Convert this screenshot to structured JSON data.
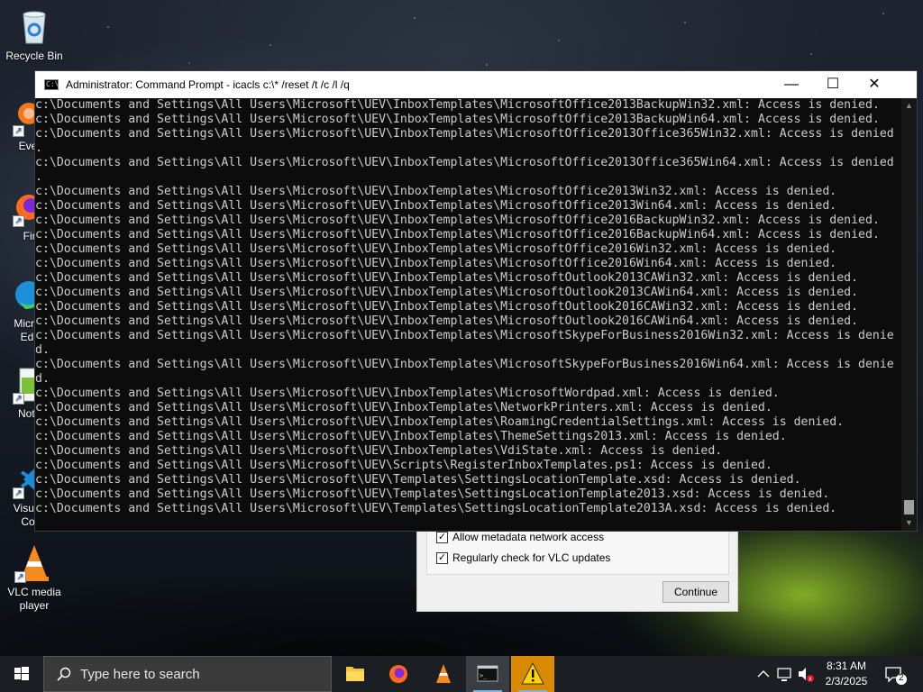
{
  "desktop": {
    "icons": [
      {
        "label": "Recycle Bin",
        "icon": "recycle-bin-icon"
      },
      {
        "label": "Every",
        "icon": "everything-icon"
      },
      {
        "label": "Fire",
        "icon": "firefox-icon"
      },
      {
        "label": "Micro Ed",
        "icon": "edge-icon"
      },
      {
        "label": "Notep",
        "icon": "notepad-icon"
      },
      {
        "label": "Visual Co",
        "icon": "vscode-icon"
      },
      {
        "label": "VLC media player",
        "icon": "vlc-icon"
      }
    ]
  },
  "vlc_dialog": {
    "check1": "Allow metadata network access",
    "check2": "Regularly check for VLC updates",
    "continue": "Continue"
  },
  "cmd": {
    "title": "Administrator: Command Prompt - icacls  c:\\* /reset /t /c /l /q",
    "lines": [
      "c:\\Documents and Settings\\All Users\\Microsoft\\UEV\\InboxTemplates\\MicrosoftOffice2013BackupWin32.xml: Access is denied.",
      "c:\\Documents and Settings\\All Users\\Microsoft\\UEV\\InboxTemplates\\MicrosoftOffice2013BackupWin64.xml: Access is denied.",
      "c:\\Documents and Settings\\All Users\\Microsoft\\UEV\\InboxTemplates\\MicrosoftOffice2013Office365Win32.xml: Access is denied",
      ".",
      "c:\\Documents and Settings\\All Users\\Microsoft\\UEV\\InboxTemplates\\MicrosoftOffice2013Office365Win64.xml: Access is denied",
      ".",
      "c:\\Documents and Settings\\All Users\\Microsoft\\UEV\\InboxTemplates\\MicrosoftOffice2013Win32.xml: Access is denied.",
      "c:\\Documents and Settings\\All Users\\Microsoft\\UEV\\InboxTemplates\\MicrosoftOffice2013Win64.xml: Access is denied.",
      "c:\\Documents and Settings\\All Users\\Microsoft\\UEV\\InboxTemplates\\MicrosoftOffice2016BackupWin32.xml: Access is denied.",
      "c:\\Documents and Settings\\All Users\\Microsoft\\UEV\\InboxTemplates\\MicrosoftOffice2016BackupWin64.xml: Access is denied.",
      "c:\\Documents and Settings\\All Users\\Microsoft\\UEV\\InboxTemplates\\MicrosoftOffice2016Win32.xml: Access is denied.",
      "c:\\Documents and Settings\\All Users\\Microsoft\\UEV\\InboxTemplates\\MicrosoftOffice2016Win64.xml: Access is denied.",
      "c:\\Documents and Settings\\All Users\\Microsoft\\UEV\\InboxTemplates\\MicrosoftOutlook2013CAWin32.xml: Access is denied.",
      "c:\\Documents and Settings\\All Users\\Microsoft\\UEV\\InboxTemplates\\MicrosoftOutlook2013CAWin64.xml: Access is denied.",
      "c:\\Documents and Settings\\All Users\\Microsoft\\UEV\\InboxTemplates\\MicrosoftOutlook2016CAWin32.xml: Access is denied.",
      "c:\\Documents and Settings\\All Users\\Microsoft\\UEV\\InboxTemplates\\MicrosoftOutlook2016CAWin64.xml: Access is denied.",
      "c:\\Documents and Settings\\All Users\\Microsoft\\UEV\\InboxTemplates\\MicrosoftSkypeForBusiness2016Win32.xml: Access is denie",
      "d.",
      "c:\\Documents and Settings\\All Users\\Microsoft\\UEV\\InboxTemplates\\MicrosoftSkypeForBusiness2016Win64.xml: Access is denie",
      "d.",
      "c:\\Documents and Settings\\All Users\\Microsoft\\UEV\\InboxTemplates\\MicrosoftWordpad.xml: Access is denied.",
      "c:\\Documents and Settings\\All Users\\Microsoft\\UEV\\InboxTemplates\\NetworkPrinters.xml: Access is denied.",
      "c:\\Documents and Settings\\All Users\\Microsoft\\UEV\\InboxTemplates\\RoamingCredentialSettings.xml: Access is denied.",
      "c:\\Documents and Settings\\All Users\\Microsoft\\UEV\\InboxTemplates\\ThemeSettings2013.xml: Access is denied.",
      "c:\\Documents and Settings\\All Users\\Microsoft\\UEV\\InboxTemplates\\VdiState.xml: Access is denied.",
      "c:\\Documents and Settings\\All Users\\Microsoft\\UEV\\Scripts\\RegisterInboxTemplates.ps1: Access is denied.",
      "c:\\Documents and Settings\\All Users\\Microsoft\\UEV\\Templates\\SettingsLocationTemplate.xsd: Access is denied.",
      "c:\\Documents and Settings\\All Users\\Microsoft\\UEV\\Templates\\SettingsLocationTemplate2013.xsd: Access is denied.",
      "c:\\Documents and Settings\\All Users\\Microsoft\\UEV\\Templates\\SettingsLocationTemplate2013A.xsd: Access is denied."
    ]
  },
  "taskbar": {
    "search_placeholder": "Type here to search",
    "time": "8:31 AM",
    "date": "2/3/2025",
    "notification_count": "2"
  }
}
